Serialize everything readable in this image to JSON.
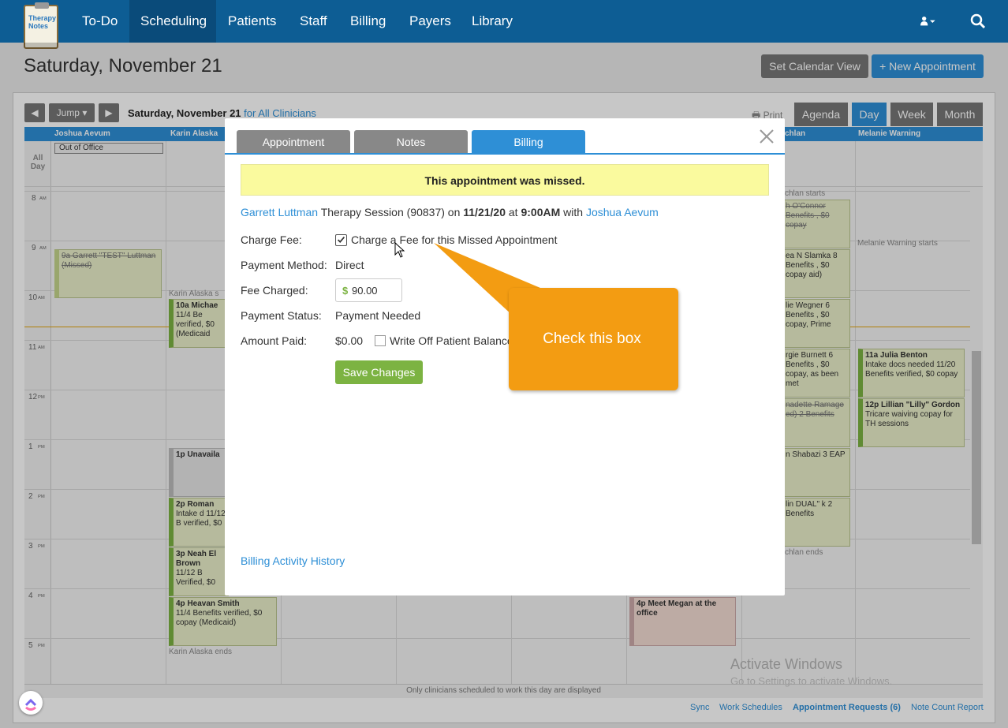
{
  "nav": {
    "logo": "Therapy Notes",
    "items": [
      "To-Do",
      "Scheduling",
      "Patients",
      "Staff",
      "Billing",
      "Payers",
      "Library"
    ],
    "active": "Scheduling"
  },
  "page": {
    "title": "Saturday, November 21",
    "set_calendar_view": "Set Calendar View",
    "new_appointment": "+ New Appointment"
  },
  "calendar": {
    "jump": "Jump",
    "date_label": "Saturday, November 21",
    "for_clinicians": "for All Clinicians",
    "print": "Print",
    "views": [
      "Agenda",
      "Day",
      "Week",
      "Month"
    ],
    "active_view": "Day",
    "clinicians": [
      "Joshua Aevum",
      "Karin Alaska",
      "chlan",
      "Melanie Warning"
    ],
    "all_day": "All Day",
    "out_of_office": "Out of Office",
    "times": [
      {
        "h": "8",
        "ap": "AM"
      },
      {
        "h": "9",
        "ap": "AM"
      },
      {
        "h": "10",
        "ap": "AM"
      },
      {
        "h": "11",
        "ap": "AM"
      },
      {
        "h": "12",
        "ap": "PM"
      },
      {
        "h": "1",
        "ap": "PM"
      },
      {
        "h": "2",
        "ap": "PM"
      },
      {
        "h": "3",
        "ap": "PM"
      },
      {
        "h": "4",
        "ap": "PM"
      },
      {
        "h": "5",
        "ap": "PM"
      }
    ],
    "appt_garrett": "9a Garrett \"TEST\" Luttman (Missed)",
    "karin_starts": "Karin Alaska s",
    "karin_ends": "Karin Alaska ends",
    "appt_michael": "10a Michae",
    "appt_michael_sub": "11/4 Be verified, $0 (Medicaid",
    "appt_unavail": "1p Unavaila",
    "appt_roman": "2p Roman",
    "appt_roman_sub": "Intake d 11/12 B verified, $0",
    "appt_neah": "3p Neah El Brown",
    "appt_neah_sub": "11/12 B Verified, $0",
    "appt_heavan": "4p Heavan Smith",
    "appt_heavan_sub": "11/4 Benefits verified, $0 copay (Medicaid)",
    "appt_megan": "4p Meet Megan at the office",
    "chlan_starts": "chlan starts",
    "chlan_ends": "chlan ends",
    "melanie_starts": "Melanie Warning starts",
    "col4_appts": [
      "h O'Connor Benefits , $0 copay",
      "ea N Slamka 8 Benefits , $0 copay aid)",
      "lie Wegner 6 Benefits , $0 copay, Prime",
      "rgie Burnett 6 Benefits , $0 copay, as been met",
      "nadette Ramage ed) 2 Benefits",
      "n Shabazi 3 EAP",
      "lin DUAL\" k 2 Benefits"
    ],
    "appt_julia": "11a Julia Benton",
    "appt_julia_sub": "Intake docs needed 11/20 Benefits verified, $0 copay",
    "appt_lillian": "12p Lillian \"Lilly\" Gordon",
    "appt_lillian_sub": "Tricare waiving copay for TH sessions",
    "footer_note": "Only clinicians scheduled to work this day are displayed",
    "footer_links": [
      "Sync",
      "Work Schedules",
      "Appointment Requests (6)",
      "Note Count Report"
    ]
  },
  "modal": {
    "tabs": [
      "Appointment",
      "Notes",
      "Billing"
    ],
    "active_tab": "Billing",
    "missed_banner": "This appointment was missed.",
    "patient_name": "Garrett Luttman",
    "session_text": "Therapy Session (90837) on",
    "date": "11/21/20",
    "at": "at",
    "time": "9:00AM",
    "with": "with",
    "clinician": "Joshua Aevum",
    "charge_fee_label": "Charge Fee:",
    "charge_fee_checkbox_label": "Charge a Fee for this Missed Appointment",
    "charge_fee_checked": true,
    "payment_method_label": "Payment Method:",
    "payment_method": "Direct",
    "fee_charged_label": "Fee Charged:",
    "fee_currency": "$",
    "fee_charged": "90.00",
    "payment_status_label": "Payment Status:",
    "payment_status": "Payment Needed",
    "amount_paid_label": "Amount Paid:",
    "amount_paid": "$0.00",
    "write_off_label": "Write Off Patient Balance",
    "save_button": "Save Changes",
    "billing_history": "Billing Activity History"
  },
  "callout": {
    "text": "Check this box",
    "color": "#f39c12"
  },
  "watermark": {
    "line1": "Activate Windows",
    "line2": "Go to Settings to activate Windows."
  },
  "colors": {
    "nav": "#0d5d94",
    "accent": "#2e8fd6",
    "save": "#7cb342",
    "banner": "#fafa9e"
  }
}
